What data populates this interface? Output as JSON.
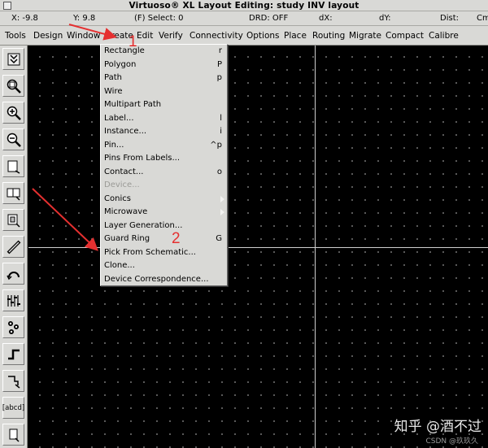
{
  "window": {
    "title": "Virtuoso® XL Layout Editing: study INV layout"
  },
  "status": {
    "x": "X: -9.8",
    "y": "Y:  9.8",
    "select": "(F) Select: 0",
    "drd": "DRD: OFF",
    "dx": "dX:",
    "dy": "dY:",
    "dist": "Dist:",
    "cmd": "Cm"
  },
  "menubar": [
    "Tools",
    "Design",
    "Window",
    "Create",
    "Edit",
    "Verify",
    "Connectivity",
    "Options",
    "Place",
    "Routing",
    "Migrate",
    "Compact",
    "Calibre"
  ],
  "create_menu": [
    {
      "label": "Rectangle",
      "key": "r"
    },
    {
      "label": "Polygon",
      "key": "P"
    },
    {
      "label": "Path",
      "key": "p"
    },
    {
      "label": "Wire",
      "key": ""
    },
    {
      "label": "Multipart Path",
      "key": ""
    },
    {
      "label": "Label...",
      "key": "l"
    },
    {
      "label": "Instance...",
      "key": "i"
    },
    {
      "label": "Pin...",
      "key": "^p"
    },
    {
      "label": "Pins From Labels...",
      "key": ""
    },
    {
      "label": "Contact...",
      "key": "o"
    },
    {
      "label": "Device...",
      "key": ""
    },
    {
      "label": "Conics",
      "key": ""
    },
    {
      "label": "Microwave",
      "key": ""
    },
    {
      "label": "Layer Generation...",
      "key": ""
    },
    {
      "label": "Guard Ring",
      "key": "G"
    },
    {
      "label": "Pick From Schematic...",
      "key": ""
    },
    {
      "label": "Clone...",
      "key": ""
    },
    {
      "label": "Device Correspondence...",
      "key": ""
    }
  ],
  "toolbar": {
    "icons": [
      "save-icon",
      "fit-view-icon",
      "zoom-in-icon",
      "zoom-out-icon",
      "stretch-icon",
      "copy-icon",
      "move-icon",
      "ruler-icon",
      "undo-icon",
      "property-icon",
      "hierarchy-icon",
      "path-icon",
      "instance-icon",
      "label-icon",
      "pin-icon"
    ],
    "label_tool_text": "[abcd]"
  },
  "annotations": {
    "marker_1": "1",
    "marker_2": "2",
    "color": "#e53030"
  },
  "watermark": {
    "main": "知乎 @酒不过",
    "sub": "CSDN @玖玖久"
  }
}
